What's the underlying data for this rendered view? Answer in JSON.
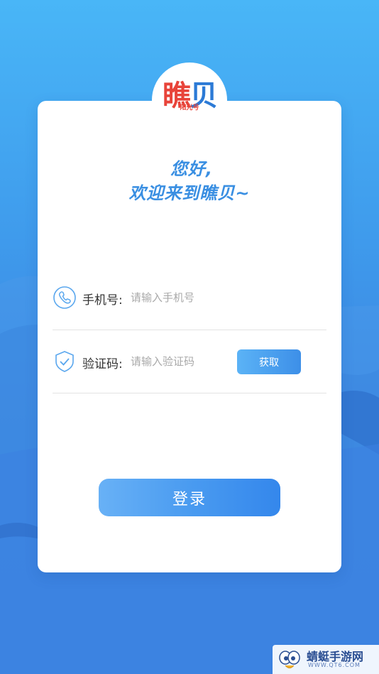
{
  "logo": {
    "char1": "瞧",
    "char2": "贝",
    "sub": "阳光号"
  },
  "greeting": {
    "line1": "您好,",
    "line2": "欢迎来到瞧贝~"
  },
  "form": {
    "phone": {
      "label": "手机号:",
      "placeholder": "请输入手机号"
    },
    "code": {
      "label": "验证码:",
      "placeholder": "请输入验证码",
      "get_button": "获取"
    },
    "login_button": "登录"
  },
  "watermark": {
    "title": "蜻蜓手游网",
    "url": "WWW.QT6.COM"
  },
  "colors": {
    "accent": "#3a8fe2",
    "background_top": "#49b6f7",
    "background_bottom": "#3b7fe2"
  }
}
